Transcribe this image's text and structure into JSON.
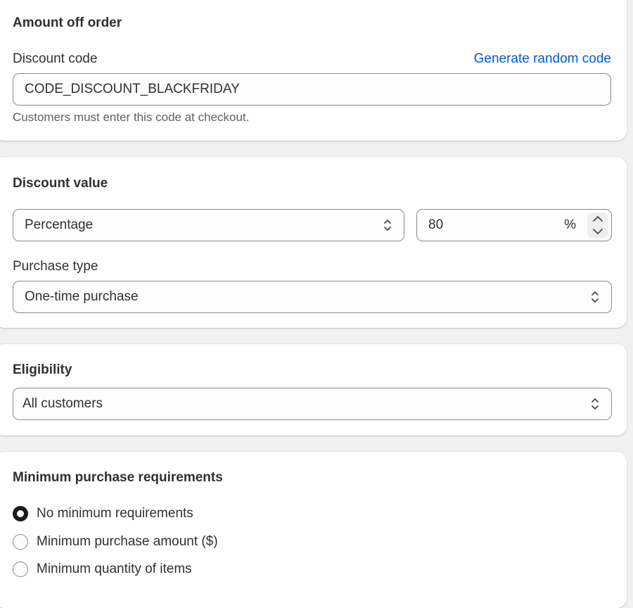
{
  "amount_off": {
    "title": "Amount off order",
    "discount_code_label": "Discount code",
    "generate_link": "Generate random code",
    "code_value": "CODE_DISCOUNT_BLACKFRIDAY",
    "help_text": "Customers must enter this code at checkout."
  },
  "discount_value": {
    "title": "Discount value",
    "type_selected": "Percentage",
    "amount": "80",
    "suffix": "%",
    "purchase_type_label": "Purchase type",
    "purchase_type_selected": "One-time purchase"
  },
  "eligibility": {
    "title": "Eligibility",
    "selected": "All customers"
  },
  "minimum": {
    "title": "Minimum purchase requirements",
    "options": [
      {
        "label": "No minimum requirements",
        "checked": true
      },
      {
        "label": "Minimum purchase amount ($)",
        "checked": false
      },
      {
        "label": "Minimum quantity of items",
        "checked": false
      }
    ]
  },
  "colors": {
    "link": "#005bd3",
    "border": "#8a8a8a",
    "text": "#303030",
    "subdued": "#616161"
  },
  "icons": {
    "select": "chevron-up-down-icon",
    "stepper": "stepper-up-down-icon"
  }
}
